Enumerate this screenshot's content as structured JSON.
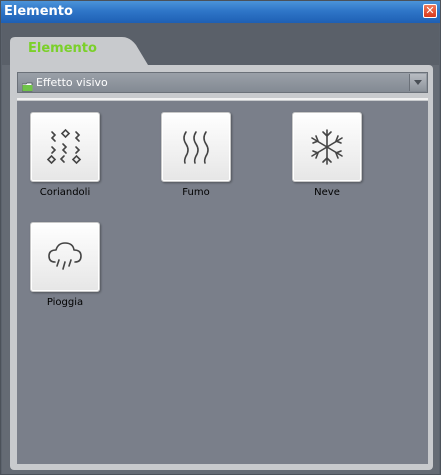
{
  "window": {
    "title": "Elemento",
    "close_icon": "close-icon",
    "colors": {
      "title_gradient_top": "#4b93d9",
      "title_gradient_bottom": "#1e5fb4",
      "close_button": "#d8391c"
    }
  },
  "tab": {
    "label": "Elemento",
    "label_color": "#7bd02a"
  },
  "dropdown": {
    "icon": "folder-icon",
    "selected_value": "Effetto visivo",
    "arrow_icon": "chevron-down-icon"
  },
  "effects": [
    {
      "label": "Coriandoli",
      "icon": "confetti-icon"
    },
    {
      "label": "Fumo",
      "icon": "smoke-icon"
    },
    {
      "label": "Neve",
      "icon": "snowflake-icon"
    },
    {
      "label": "Pioggia",
      "icon": "rain-cloud-icon"
    }
  ]
}
